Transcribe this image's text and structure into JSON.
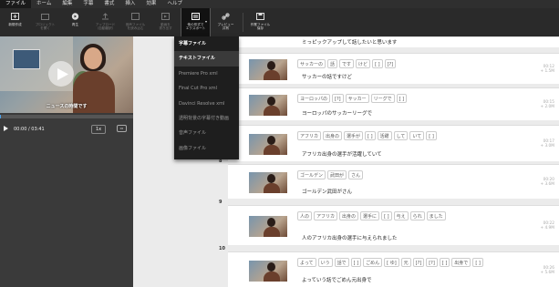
{
  "menubar": [
    "ファイル",
    "ホーム",
    "編集",
    "字幕",
    "書式",
    "挿入",
    "効果",
    "ヘルプ"
  ],
  "toolbar": {
    "new_project": "新規作成",
    "item2_line1": "プロジェクト",
    "item2_line2": "を開く",
    "recognize": "再生",
    "item4_line1": "アップロード",
    "item4_line2": "（自動翻訳）",
    "item5_line1": "音声ファイル",
    "item5_line2": "を読み込む",
    "item6_line1": "動画を",
    "item6_line2": "書き出す",
    "export_line1": "他の形式で",
    "export_line2": "エクスポート",
    "share_line1": "プレビュー",
    "share_line2": "共有",
    "work_line1": "作業ファイル",
    "work_line2": "保存"
  },
  "player": {
    "subtitle": "ニュースの時間です",
    "time": "00:00 / 03:41",
    "speed": "1x",
    "progress": 0.01
  },
  "export_menu": [
    "字幕ファイル",
    "テキストファイル",
    "Premiere Pro xml",
    "Final Cut Pro xml",
    "Davinci Resolve xml",
    "透明背景の字幕付き動画",
    "音声ファイル",
    "画像ファイル"
  ],
  "rows": [
    {
      "num": "",
      "words": [],
      "sentence": "ミっピックアップして話したいと思います",
      "time": ""
    },
    {
      "num": "",
      "words": [
        "サッカーの",
        "話",
        "です",
        "けど",
        "[ ]",
        "[?]"
      ],
      "sentence": "サッカーの話ですけど",
      "time": "00:12\n+ 1.5M"
    },
    {
      "num": "",
      "words": [
        "ヨーロッパの",
        "[?]",
        "サッカー",
        "リーグで",
        "[ ]"
      ],
      "sentence": "ヨーロッパのサッカーリーグで",
      "time": "00:15\n+ 2.0M"
    },
    {
      "num": "",
      "words": [
        "アフリカ",
        "出身の",
        "選手が",
        "[ ]",
        "活躍",
        "して",
        "いて",
        "[ ]"
      ],
      "sentence": "アフリカ出身の選手が活躍していて",
      "time": "00:17\n+ 3.0M"
    },
    {
      "num": "8",
      "words": [
        "ゴールデン",
        "武田が",
        "さん"
      ],
      "sentence": "ゴールデン武田がさん",
      "time": "00:20\n+ 3.6M"
    },
    {
      "num": "9",
      "words": [
        "人の",
        "アフリカ",
        "出身の",
        "選手に",
        "[ ]",
        "与え",
        "られ",
        "ました"
      ],
      "sentence": "人のアフリカ出身の選手に与えられました",
      "time": "00:22\n+ 4.9M"
    },
    {
      "num": "10",
      "words": [
        "よって",
        "いう",
        "話で",
        "[ ]",
        "ごめん",
        "[ ゆ]",
        "元",
        "[?]",
        "[?]",
        "[ ]",
        "出身で",
        "[ ]"
      ],
      "sentence": "よっていう話でごめん元出身で",
      "time": "00:26\n+ 5.6M"
    }
  ]
}
